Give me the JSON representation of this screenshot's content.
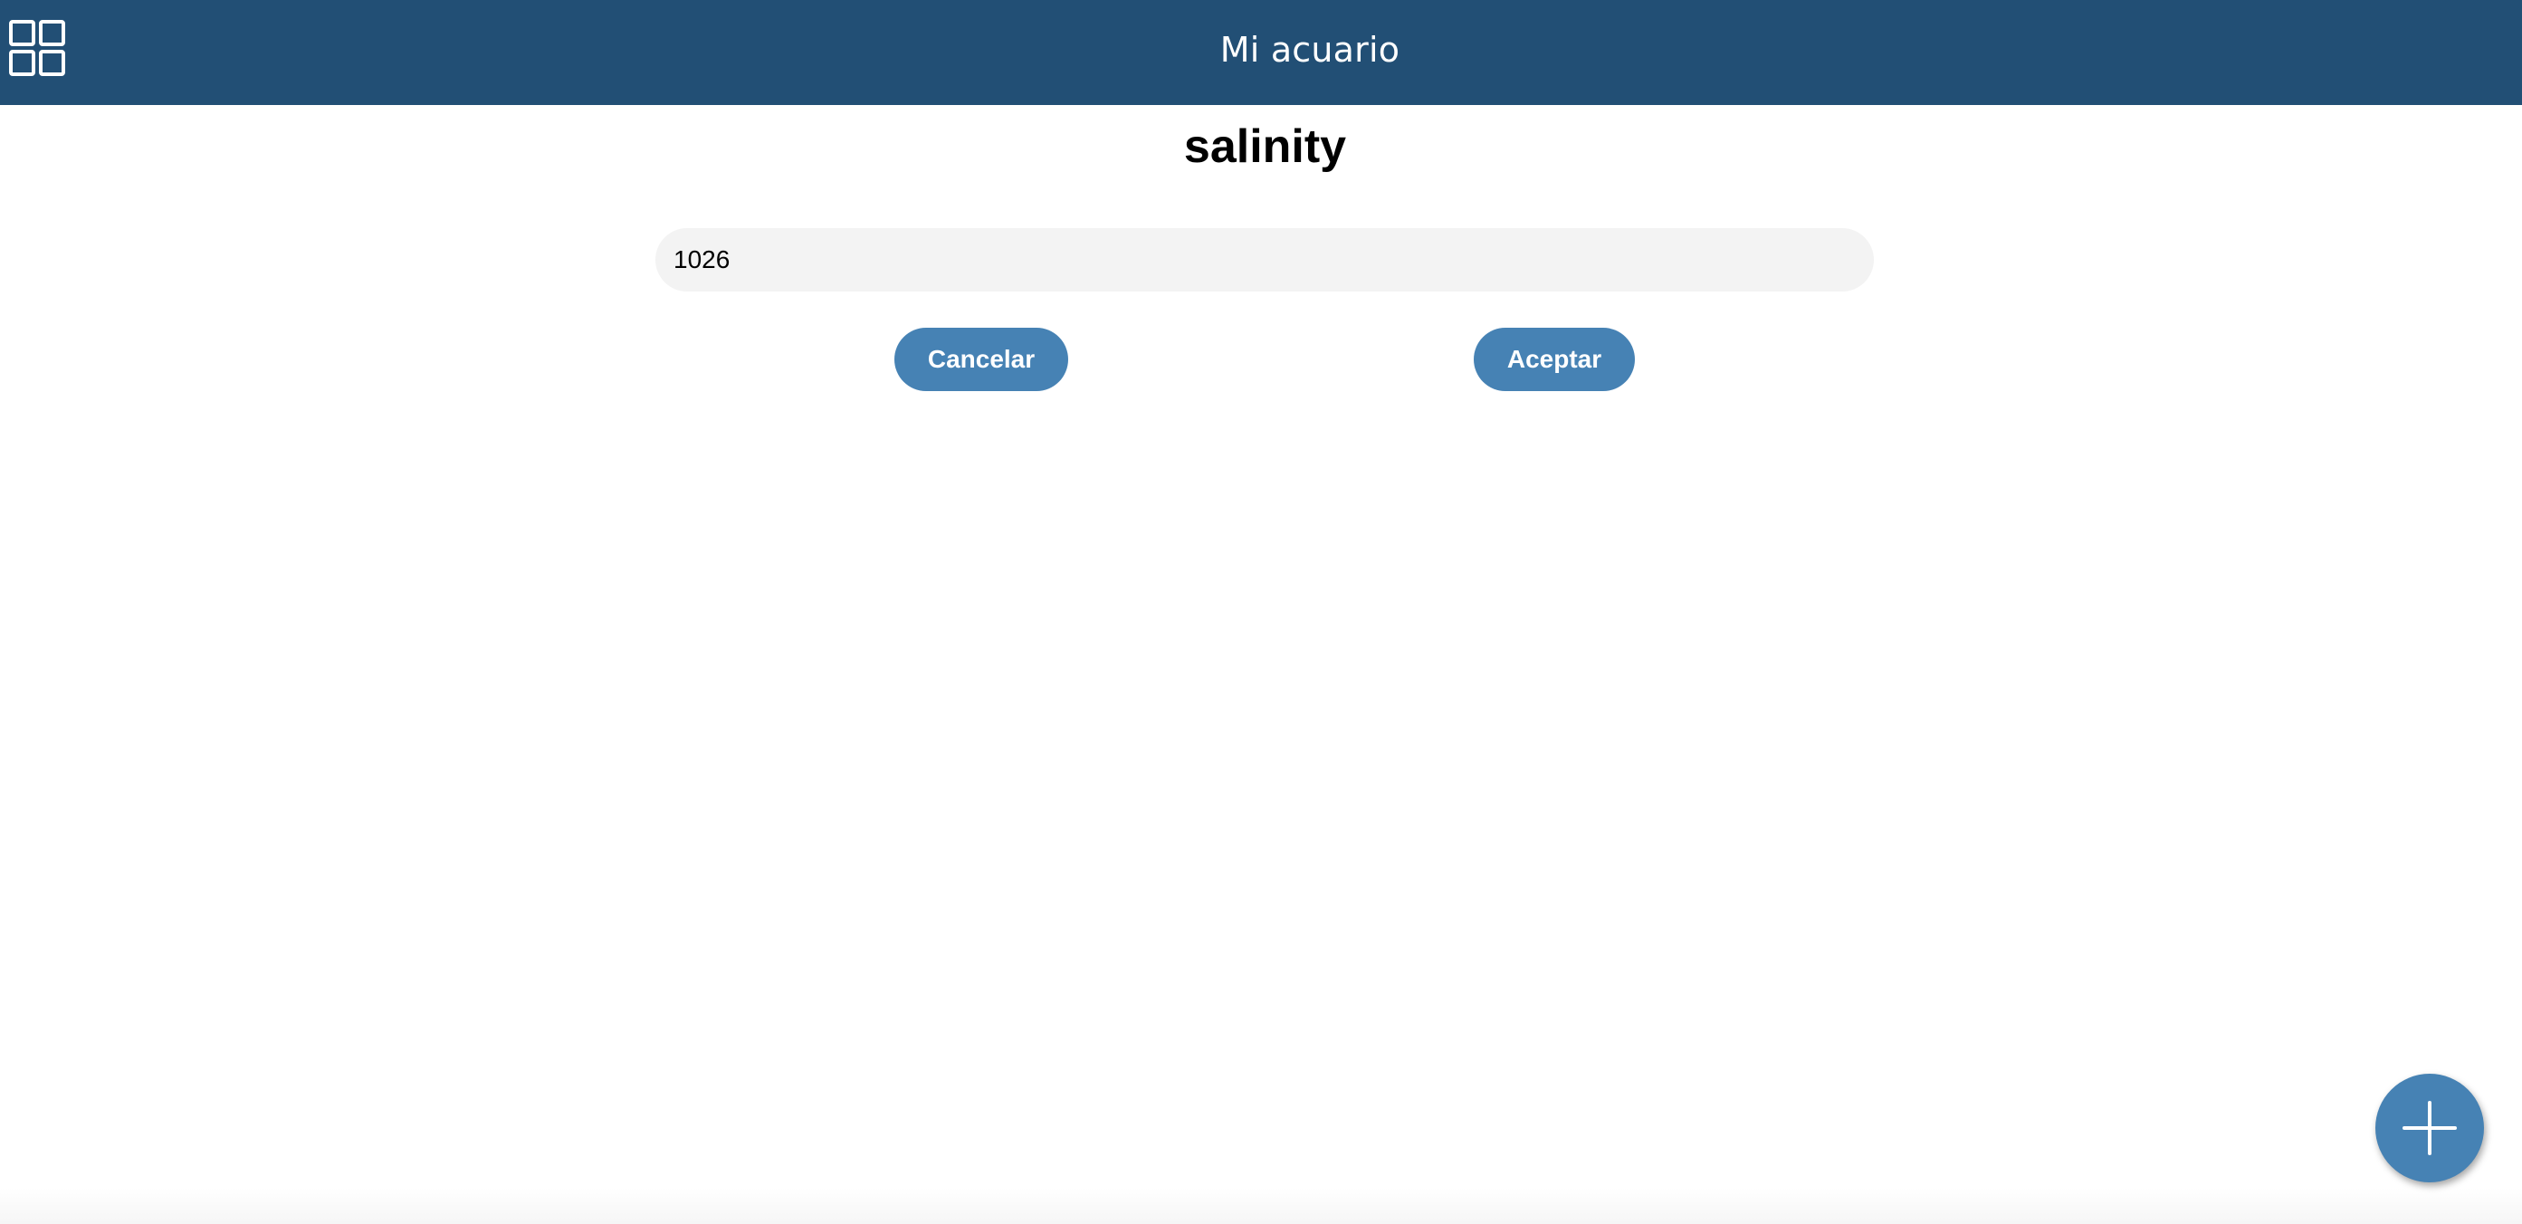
{
  "header": {
    "title": "Mi acuario",
    "menu_icon": "grid-icon",
    "background_color": "#224f75"
  },
  "main": {
    "title": "salinity",
    "input": {
      "value": "1026",
      "placeholder": ""
    },
    "buttons": {
      "cancel_label": "Cancelar",
      "accept_label": "Aceptar"
    },
    "accent_color": "#4682b4"
  },
  "fab": {
    "icon": "plus-icon"
  }
}
